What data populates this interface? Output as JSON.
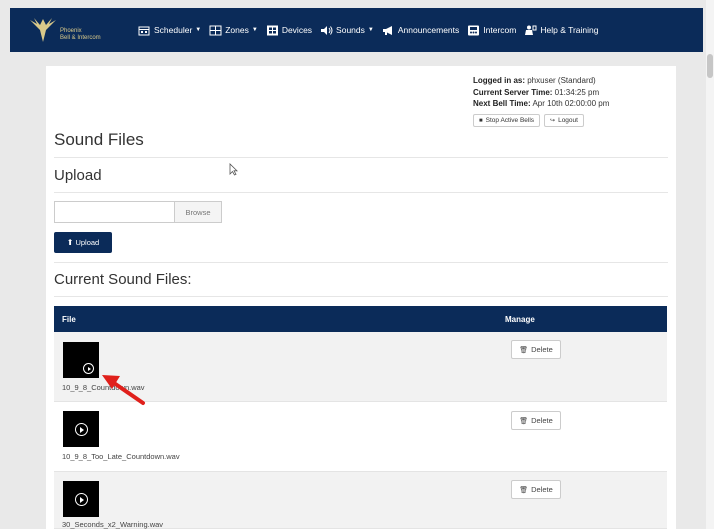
{
  "brand": {
    "line1": "Phoenix",
    "line2": "Bell & Intercom",
    "logo_icon": "phoenix-logo"
  },
  "nav": [
    {
      "key": "scheduler",
      "label": "Scheduler",
      "icon": "calendar-icon",
      "dropdown": true
    },
    {
      "key": "zones",
      "label": "Zones",
      "icon": "zones-icon",
      "dropdown": true
    },
    {
      "key": "devices",
      "label": "Devices",
      "icon": "devices-icon",
      "dropdown": false
    },
    {
      "key": "sounds",
      "label": "Sounds",
      "icon": "speaker-icon",
      "dropdown": true
    },
    {
      "key": "announcements",
      "label": "Announcements",
      "icon": "megaphone-icon",
      "dropdown": false
    },
    {
      "key": "intercom",
      "label": "Intercom",
      "icon": "intercom-icon",
      "dropdown": false
    },
    {
      "key": "help",
      "label": "Help & Training",
      "icon": "help-icon",
      "dropdown": false
    }
  ],
  "session": {
    "logged_in_label": "Logged in as:",
    "logged_in_value": "phxuser (Standard)",
    "server_time_label": "Current Server Time:",
    "server_time_value": "01:34:25 pm",
    "next_bell_label": "Next Bell Time:",
    "next_bell_value": "Apr 10th 02:00:00 pm",
    "stop_label": "Stop Active Bells",
    "logout_label": "Logout"
  },
  "page": {
    "title": "Sound Files",
    "upload_heading": "Upload",
    "file_input_value": "",
    "browse_label": "Browse",
    "upload_button": "Upload",
    "current_heading": "Current Sound Files:"
  },
  "table": {
    "col_file": "File",
    "col_manage": "Manage",
    "rows": [
      {
        "filename": "10_9_8_Countdown.wav",
        "delete_label": "Delete"
      },
      {
        "filename": "10_9_8_Too_Late_Countdown.wav",
        "delete_label": "Delete"
      },
      {
        "filename": "30_Seconds_x2_Warning.wav",
        "delete_label": "Delete"
      }
    ]
  },
  "colors": {
    "navbar": "#0b2b59",
    "annotation_arrow": "#e0201b",
    "brand_gold": "#d9c98a"
  }
}
